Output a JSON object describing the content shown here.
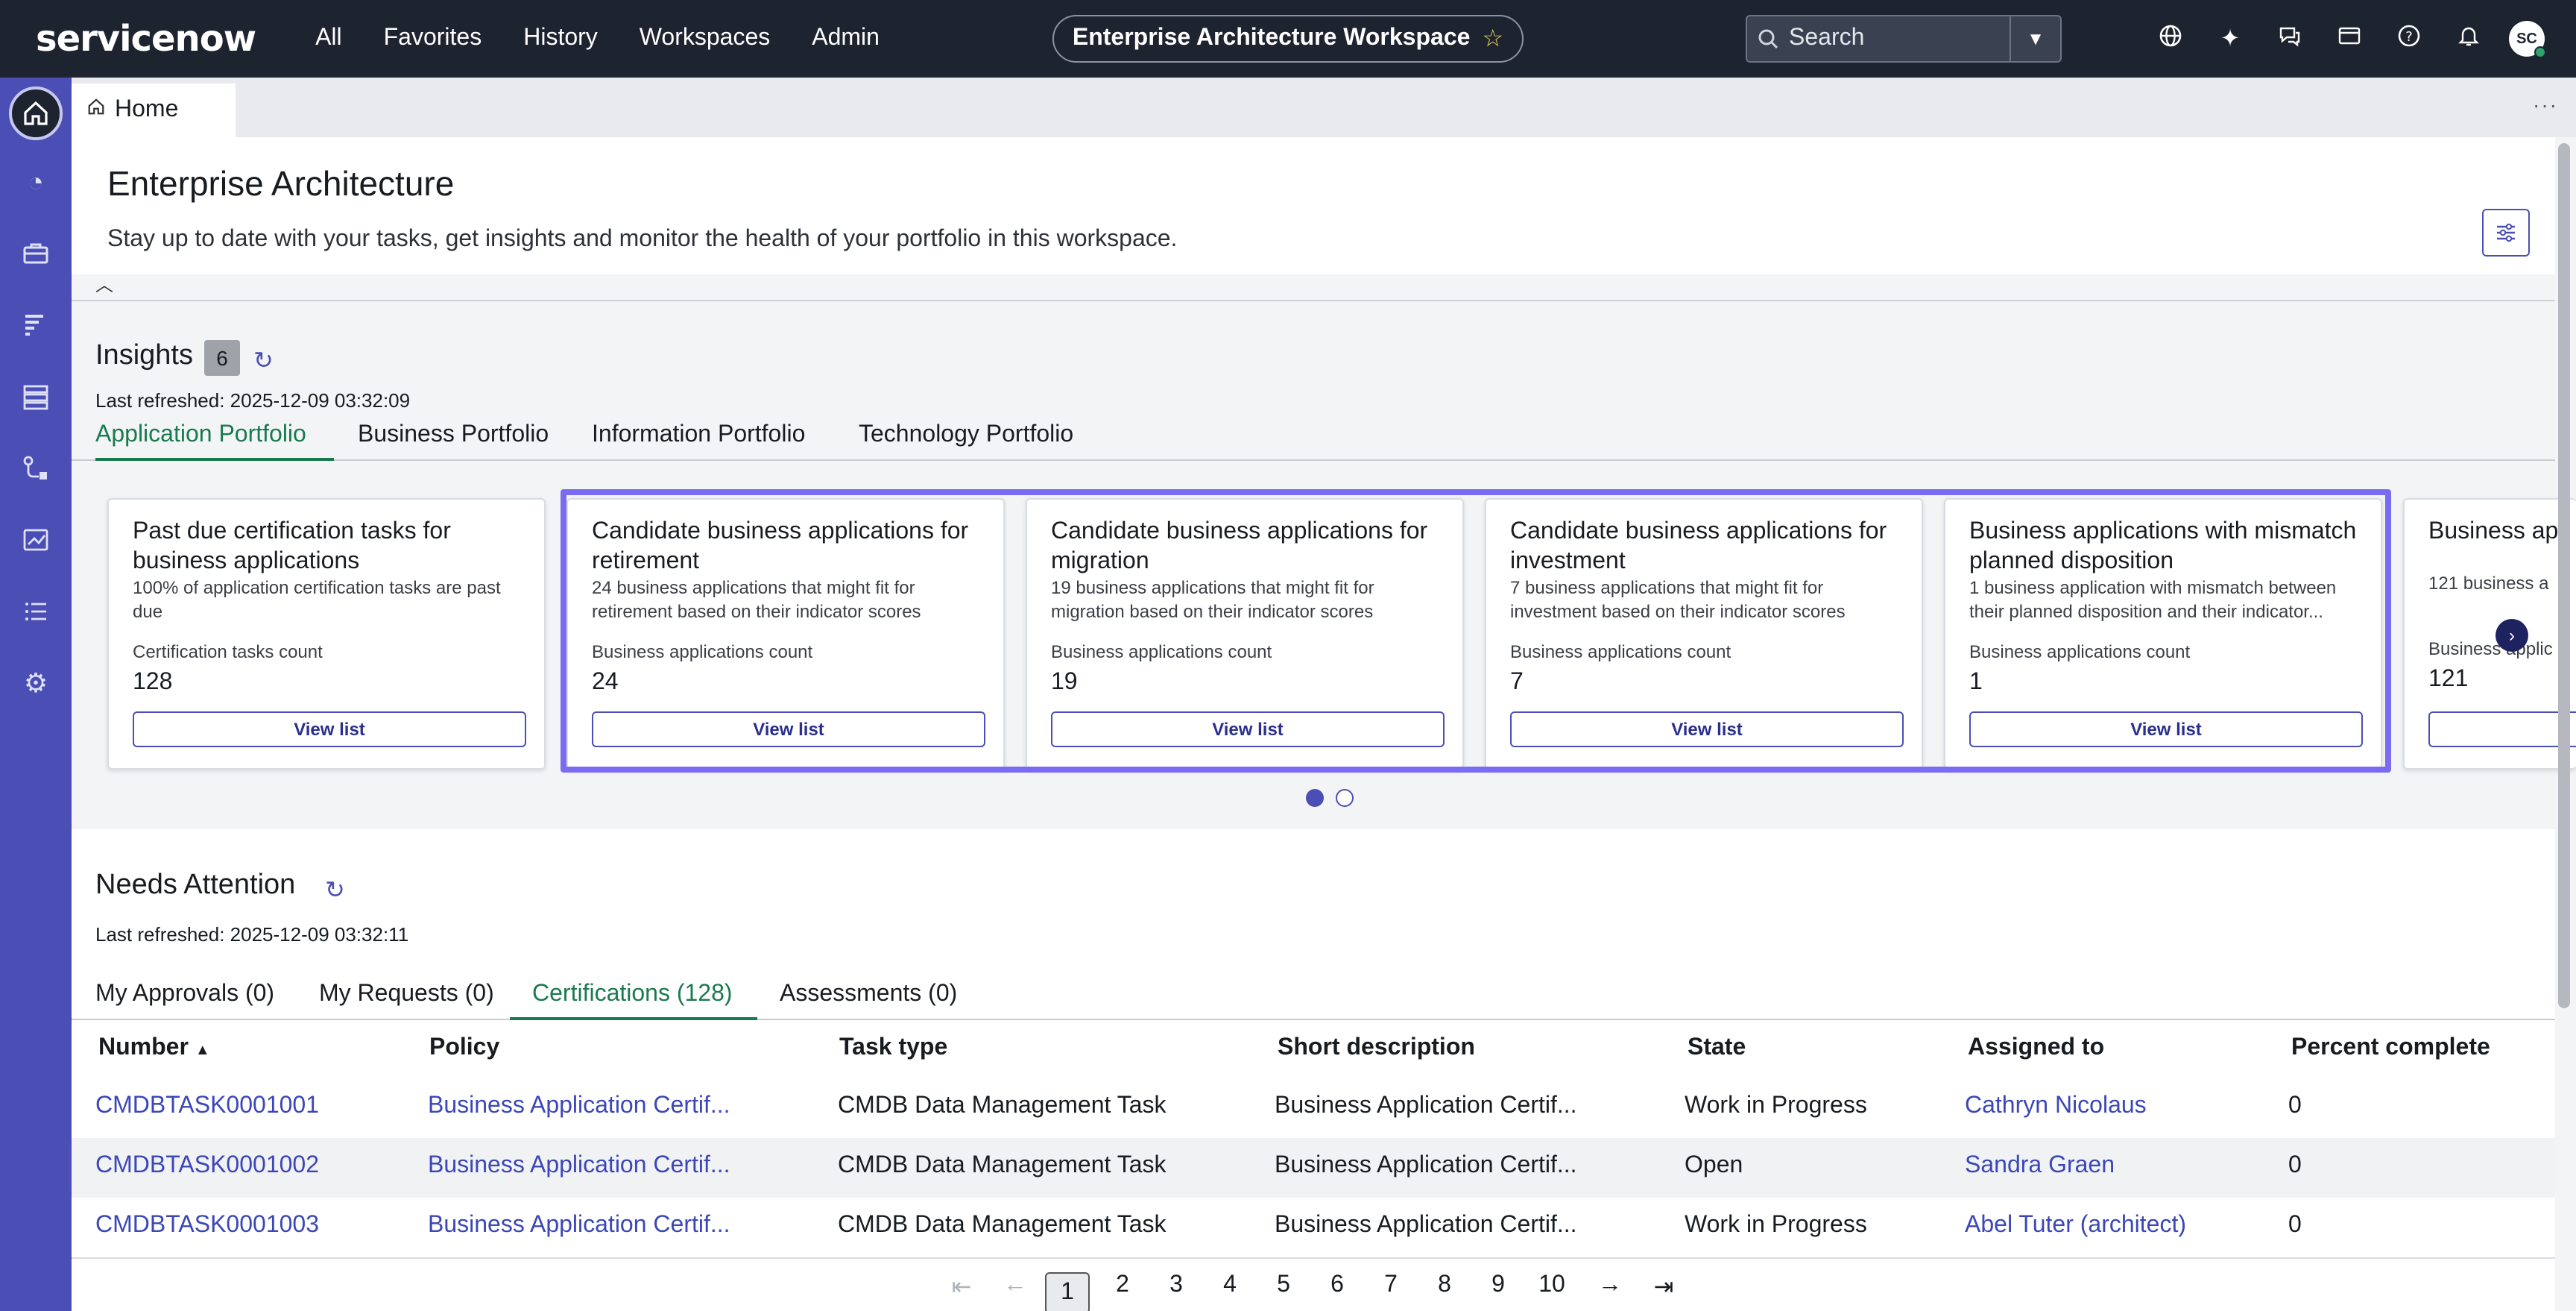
{
  "header": {
    "logo": "servicenow",
    "nav": [
      "All",
      "Favorites",
      "History",
      "Workspaces",
      "Admin"
    ],
    "workspace": "Enterprise Architecture Workspace",
    "search_placeholder": "Search",
    "avatar_initials": "SC",
    "icons": [
      "globe-icon",
      "sparkle-icon",
      "chat-icon",
      "card-icon",
      "help-icon",
      "bell-icon"
    ]
  },
  "rail": {
    "items": [
      "home-icon",
      "analytics-icon",
      "briefcase-icon",
      "report-icon",
      "database-icon",
      "flow-icon",
      "dashboard-icon",
      "list-icon",
      "settings-icon"
    ]
  },
  "tabstrip": {
    "home_label": "Home"
  },
  "page": {
    "title": "Enterprise Architecture",
    "subtitle": "Stay up to date with your tasks, get insights and monitor the health of your portfolio in this workspace."
  },
  "insights": {
    "title": "Insights",
    "count": "6",
    "last_refreshed": "Last refreshed: 2025-12-09 03:32:09",
    "tabs": [
      "Application Portfolio",
      "Business Portfolio",
      "Information Portfolio",
      "Technology Portfolio"
    ],
    "active_tab": "Application Portfolio",
    "view_list_label": "View list",
    "cards": [
      {
        "title": "Past due certification tasks for business applications",
        "desc": "100% of application certification tasks are past due",
        "label": "Certification tasks count",
        "value": "128"
      },
      {
        "title": "Candidate business applications for retirement",
        "desc": "24 business applications that might fit for retirement based on their indicator scores",
        "label": "Business applications count",
        "value": "24"
      },
      {
        "title": "Candidate business applications for migration",
        "desc": "19 business applications that might fit for migration based on their indicator scores",
        "label": "Business applications count",
        "value": "19"
      },
      {
        "title": "Candidate business applications for investment",
        "desc": "7 business applications that might fit for investment based on their indicator scores",
        "label": "Business applications count",
        "value": "7"
      },
      {
        "title": "Business applications with mismatch planned disposition",
        "desc": "1 business application with mismatch between their planned disposition and their indicator...",
        "label": "Business applications count",
        "value": "1"
      },
      {
        "title": "Business ap",
        "desc": "121 business a",
        "label": "Business applic",
        "value": "121"
      }
    ],
    "carousel_pages": 2,
    "carousel_active": 1
  },
  "needs_attention": {
    "title": "Needs Attention",
    "last_refreshed": "Last refreshed: 2025-12-09 03:32:11",
    "tabs": [
      "My Approvals (0)",
      "My Requests (0)",
      "Certifications (128)",
      "Assessments (0)"
    ],
    "active_tab": "Certifications (128)",
    "columns": [
      "Number",
      "Policy",
      "Task type",
      "Short description",
      "State",
      "Assigned to",
      "Percent complete"
    ],
    "sort_indicator": "▲",
    "rows": [
      [
        "CMDBTASK0001001",
        "Business Application Certif...",
        "CMDB Data Management Task",
        "Business Application Certif...",
        "Work in Progress",
        "Cathryn Nicolaus",
        "0"
      ],
      [
        "CMDBTASK0001002",
        "Business Application Certif...",
        "CMDB Data Management Task",
        "Business Application Certif...",
        "Open",
        "Sandra Graen",
        "0"
      ],
      [
        "CMDBTASK0001003",
        "Business Application Certif...",
        "CMDB Data Management Task",
        "Business Application Certif...",
        "Work in Progress",
        "Abel Tuter (architect)",
        "0"
      ]
    ],
    "pagination": {
      "pages": [
        "1",
        "2",
        "3",
        "4",
        "5",
        "6",
        "7",
        "8",
        "9",
        "10"
      ],
      "current": "1",
      "first": "⇤",
      "prev": "←",
      "next": "→",
      "last": "⇥"
    }
  },
  "colors": {
    "header_bg": "#1e2330",
    "rail_bg": "#4b4fb5",
    "accent_green": "#1a7a4f",
    "link_blue": "#3b47b8",
    "highlight": "#7a6cf0"
  }
}
